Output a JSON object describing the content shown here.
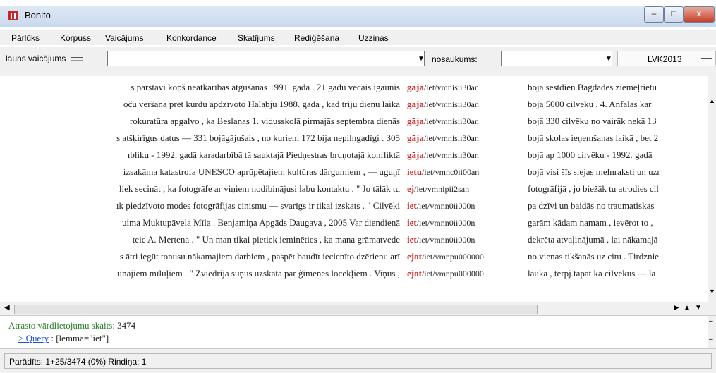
{
  "window": {
    "title": "Bonito"
  },
  "menu": [
    "Pārlūks",
    "Korpuss",
    "Vaicājums",
    "Konkordance",
    "Skatījums",
    "Rediģēšana",
    "Uzziņas"
  ],
  "toolbar": {
    "query_type": "launs vaicājums",
    "query_value": "",
    "name_label": "nosaukums:",
    "name_value": "",
    "corpus": "LVK2013"
  },
  "concordance": [
    {
      "left": "s pārstāvi kopš neatkarības atgūšanas 1991.   gadā . 21 gadu vecais igaunis",
      "kw": "gāja",
      "tag": "/iet/vmnisii30an",
      "right": "bojā sestdien Bagdādes ziemeļrietu"
    },
    {
      "left": "ōču vēršana pret kurdu apdzīvoto Halabju 1988.   gadā , kad triju dienu laikā",
      "kw": "gāja",
      "tag": "/iet/vmnisii30an",
      "right": "bojā 5000 cilvēku . 4.   Anfalas kar"
    },
    {
      "left": "rokuratūra apgalvo , ka Beslanas 1.   vidusskolā pirmajās septembra dienās",
      "kw": "gāja",
      "tag": "/iet/vmnisii30an",
      "right": "bojā 330 cilvēku no vairāk nekā 13"
    },
    {
      "left": "s atšķirīgus datus — 331 bojāgājušais , no kuriem 172 bija nepilngadīgi . 305",
      "kw": "gāja",
      "tag": "/iet/vmnisii30an",
      "right": "bojā skolas ieņemšanas laikā , bet 2"
    },
    {
      "left": "ıbliku - 1992.   gadā karadarbībā tā sauktajā Piedņestras bruņotajā konfliktā",
      "kw": "gāja",
      "tag": "/iet/vmnisii30an",
      "right": "bojā ap 1000 cilvēku - 1992.   gadā"
    },
    {
      "left": "izsakāma katastrofa UNESCO aprūpētajiem kultūras dārgumiem , — uguņī",
      "kw": "ietu",
      "tag": "/iet/vmnc0ii00an",
      "right": "bojā visi šīs slejas melnraksti un uzr"
    },
    {
      "left": "liek secināt , ka fotogrāfe ar viņiem nodibinājusi labu kontaktu . \" Jo tālāk tu",
      "kw": "ej",
      "tag": "/iet/vmnipii2san",
      "right": "fotogrāfijā , jo biežāk tu atrodies cil"
    },
    {
      "left": "ık piedzīvoto modes fotogrāfijas cinismu — svarīgs ir tikai izskats . \" Cilvēki",
      "kw": "iet",
      "tag": "/iet/vmnn0ii000n",
      "right": "pa dzīvi un baidās no traumatiskas"
    },
    {
      "left": "uima Muktupāvela Mīla . Benjamiņa Apgāds Daugava , 2005 Var diendienā",
      "kw": "iet",
      "tag": "/iet/vmnn0ii000n",
      "right": "garām kādam namam , ievērot to ,"
    },
    {
      "left": "teic A.   Mertena . \" Un man tikai pietiek ieminēties , ka mana grāmatvede",
      "kw": "iet",
      "tag": "/iet/vmnn0ii000n",
      "right": "dekrēta atvaļinājumā , lai nākamajā"
    },
    {
      "left": "s ātri iegūt tonusu nākamajiem darbiem , paspēt baudīt iecienīto dzērienu arī",
      "kw": "ejot",
      "tag": "/iet/vmnpu000000",
      "right": "no vienas tikšanās uz citu . Tirdznie"
    },
    {
      "left": "ıinajiem mīluļiem . \" Zviedrijā suņus uzskata par ģimenes locekļiem . Viņus ,",
      "kw": "ejot",
      "tag": "/iet/vmnpu000000",
      "right": "laukā , tērpj tāpat kā cilvēkus — la"
    }
  ],
  "info": {
    "count_label": "Atrasto vārdlietojumu skaits:",
    "count_value": "3474",
    "query_prefix": "> Query",
    "query_text": ": [lemma=\"iet\"]"
  },
  "status": {
    "text": "Parādīts: 1+25/3474  (0%)  Rindiņa: 1"
  },
  "colors": {
    "keyword": "#d01f1f",
    "info_text": "#2e7d2e",
    "query_link": "#1a4fd6"
  }
}
